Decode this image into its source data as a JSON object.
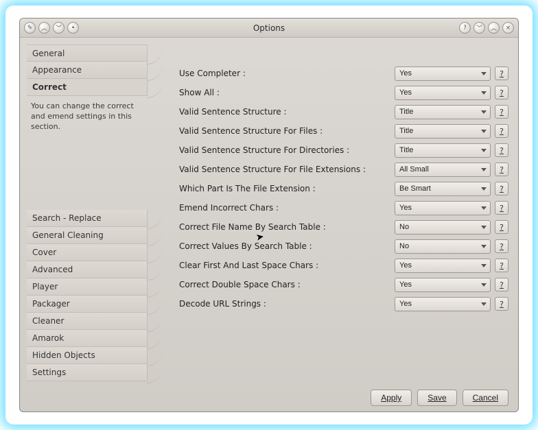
{
  "window": {
    "title": "Options"
  },
  "sidebar": {
    "top": [
      {
        "label": "General"
      },
      {
        "label": "Appearance"
      },
      {
        "label": "Correct"
      }
    ],
    "description": "You can change the correct and emend settings in this section.",
    "bottom": [
      {
        "label": "Search - Replace"
      },
      {
        "label": "General Cleaning"
      },
      {
        "label": "Cover"
      },
      {
        "label": "Advanced"
      },
      {
        "label": "Player"
      },
      {
        "label": "Packager"
      },
      {
        "label": "Cleaner"
      },
      {
        "label": "Amarok"
      },
      {
        "label": "Hidden Objects"
      },
      {
        "label": "Settings"
      }
    ]
  },
  "settings": [
    {
      "label": "Use Completer :",
      "value": "Yes"
    },
    {
      "label": "Show All :",
      "value": "Yes"
    },
    {
      "label": "Valid Sentence Structure :",
      "value": "Title"
    },
    {
      "label": "Valid Sentence Structure For Files :",
      "value": "Title"
    },
    {
      "label": "Valid Sentence Structure For Directories :",
      "value": "Title"
    },
    {
      "label": "Valid Sentence Structure For File Extensions :",
      "value": "All Small"
    },
    {
      "label": "Which Part Is The File Extension :",
      "value": "Be Smart"
    },
    {
      "label": "Emend Incorrect Chars :",
      "value": "Yes"
    },
    {
      "label": "Correct File Name By Search Table :",
      "value": "No"
    },
    {
      "label": "Correct Values By Search Table :",
      "value": "No"
    },
    {
      "label": "Clear First And Last Space Chars :",
      "value": "Yes"
    },
    {
      "label": "Correct Double Space Chars :",
      "value": "Yes"
    },
    {
      "label": "Decode URL Strings :",
      "value": "Yes"
    }
  ],
  "footer": {
    "apply": "Apply",
    "save": "Save",
    "cancel": "Cancel"
  },
  "help_glyph": "?"
}
